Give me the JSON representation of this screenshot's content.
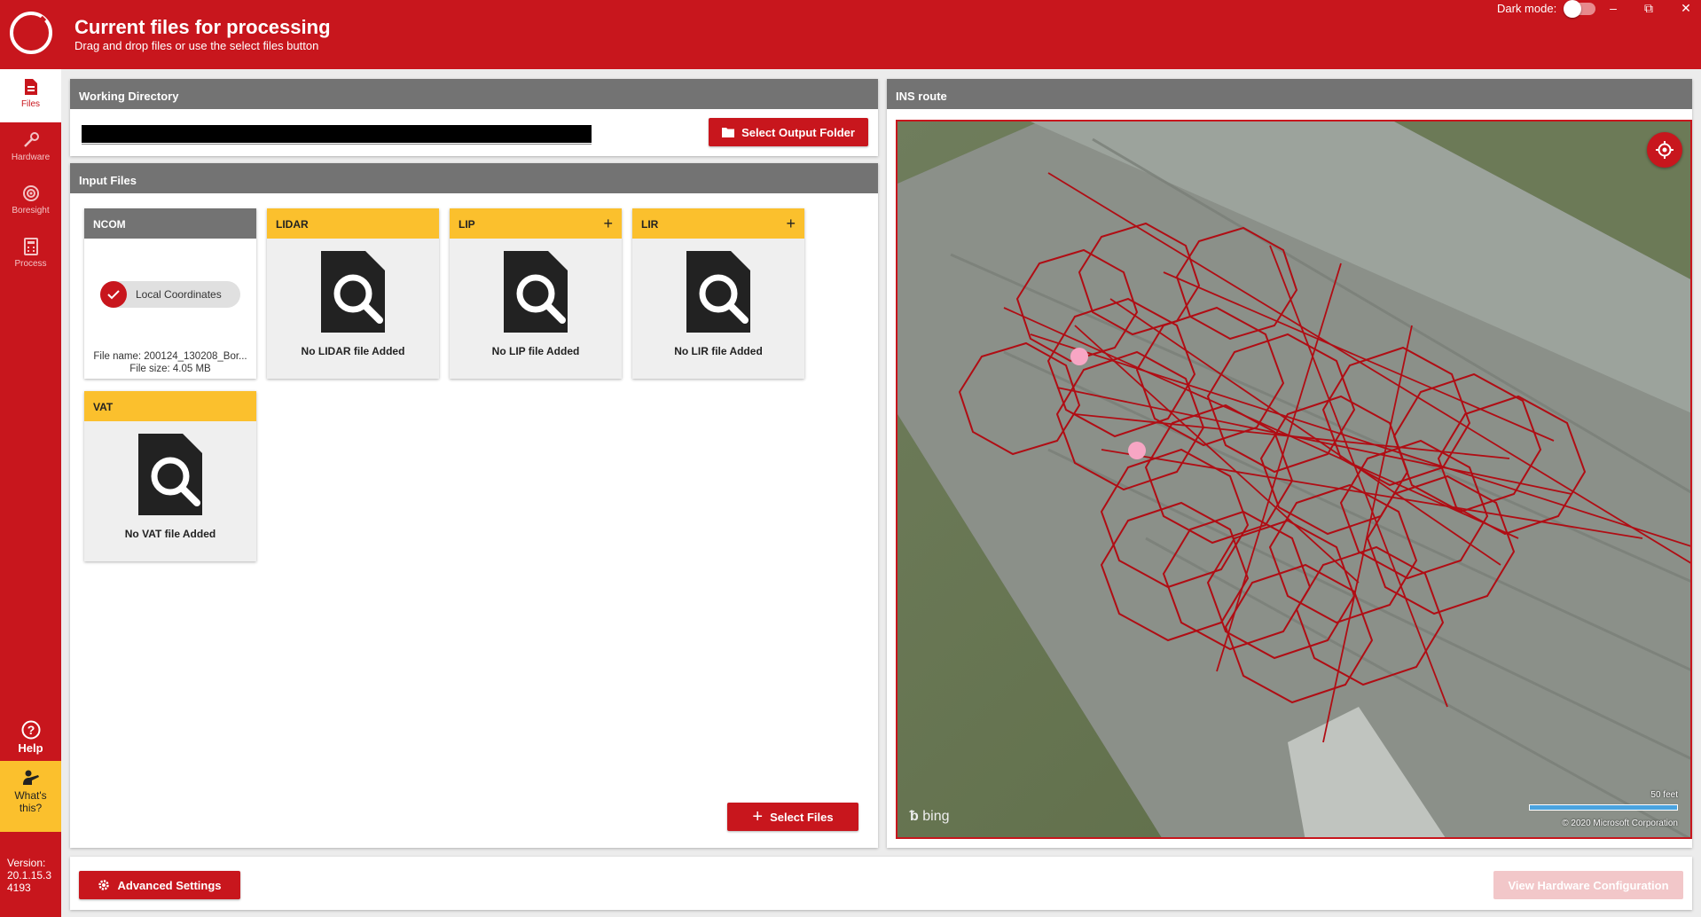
{
  "app": {
    "title": "Current files for processing",
    "subtitle": "Drag and drop files or use the select files button",
    "dark_mode_label": "Dark mode:",
    "dark_mode_on": false,
    "window_controls": {
      "minimize": "–",
      "maximize": "⧉",
      "close": "✕"
    }
  },
  "colors": {
    "brand_red": "#c8161d",
    "accent_yellow": "#fbc02d",
    "panel_header": "#737373"
  },
  "sidebar": {
    "items": [
      {
        "label": "Files",
        "icon": "file-icon",
        "active": true
      },
      {
        "label": "Hardware",
        "icon": "wrench-icon",
        "active": false
      },
      {
        "label": "Boresight",
        "icon": "target-icon",
        "active": false
      },
      {
        "label": "Process",
        "icon": "calculator-icon",
        "active": false
      }
    ],
    "help_label": "Help",
    "whats_this_label_1": "What's",
    "whats_this_label_2": "this?",
    "version_label": "Version:",
    "version_number": "20.1.15.3",
    "build_number": "4193"
  },
  "working_directory": {
    "title": "Working Directory",
    "select_output_label": "Select Output Folder"
  },
  "input_files": {
    "title": "Input Files",
    "ncom": {
      "title": "NCOM",
      "chip_label": "Local Coordinates",
      "file_name": "File name: 200124_130208_Bor...",
      "file_size": "File size: 4.05 MB"
    },
    "lidar": {
      "title": "LIDAR",
      "empty_label": "No LIDAR file Added"
    },
    "lip": {
      "title": "LIP",
      "empty_label": "No LIP file Added",
      "add": "+"
    },
    "lir": {
      "title": "LIR",
      "empty_label": "No LIR file Added",
      "add": "+"
    },
    "vat": {
      "title": "VAT",
      "empty_label": "No VAT file Added"
    },
    "select_files_label": "Select Files"
  },
  "ins_route": {
    "title": "INS route",
    "map_provider": "bing",
    "scale_label": "50 feet",
    "copyright": "© 2020 Microsoft Corporation"
  },
  "footer": {
    "advanced_settings_label": "Advanced Settings",
    "view_hardware_label": "View Hardware Configuration",
    "view_hardware_enabled": false
  }
}
